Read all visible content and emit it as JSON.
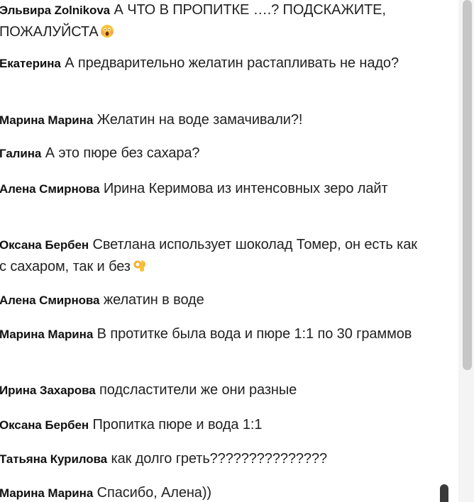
{
  "comments": [
    {
      "author": "Эльвира Zolnikova",
      "text": "А ЧТО В ПРОПИТКЕ ….? ПОДСКАЖИТЕ, ПОЖАЛУЙСТА",
      "emoji": "screaming-face-icon"
    },
    {
      "author": "Екатерина",
      "text": "А предварительно желатин растапливать не надо?"
    },
    {
      "author": "Марина Марина",
      "text": "Желатин на воде замачивали?!"
    },
    {
      "author": "Галина",
      "text": "А это пюре без сахара?"
    },
    {
      "author": "Алена Смирнова",
      "text": "Ирина Керимова из интенсовных зеро лайт"
    },
    {
      "author": "Оксана Бербен",
      "text": "Светлана использует шоколад Томер, он есть как с сахаром, так и без",
      "emoji": "ok-hand-icon"
    },
    {
      "author": "Алена Смирнова",
      "text": "желатин в воде"
    },
    {
      "author": "Марина Марина",
      "text": "В протитке была вода и пюре 1:1 по 30 граммов"
    },
    {
      "author": "Ирина Захарова",
      "text": "подсластители же они разные"
    },
    {
      "author": "Оксана Бербен",
      "text": "Пропитка пюре и вода 1:1"
    },
    {
      "author": "Татьяна Курилова",
      "text": "как долго греть???????????????"
    },
    {
      "author": "Марина Марина",
      "text": "Спасибо, Алена))"
    }
  ],
  "colors": {
    "text": "#222222",
    "author": "#111111",
    "scroll_track": "#f4f4f4",
    "scroll_thumb": "#c6c6c6",
    "emoji_yellow": "#f7c33a"
  }
}
